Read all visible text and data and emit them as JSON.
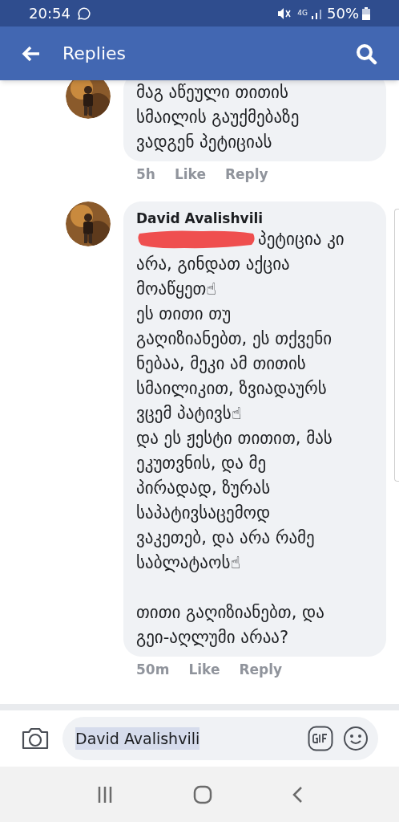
{
  "status_bar": {
    "time": "20:54",
    "battery": "50%",
    "network": "4G"
  },
  "header": {
    "title": "Replies"
  },
  "comments": [
    {
      "kind": "clipped",
      "paragraphs": [
        [
          "მაგ აწეული თითის",
          "სმაილის გაუქმებაზე",
          "ვადგენ პეტიციას"
        ]
      ],
      "time": "5h",
      "actions": [
        "Like",
        "Reply"
      ]
    },
    {
      "kind": "full",
      "author": "David Avalishvili",
      "redacted": true,
      "paragraphs": [
        [
          "პეტიცია კი",
          "არა, გინდათ აქცია",
          "მოაწყეთ☝",
          "ეს თითი თუ",
          "გაღიზიანებთ, ეს თქვენი",
          "ნებაა, მეკი ამ თითის",
          "სმაილიკით, ზვიადაურს",
          "ვცემ პატივს☝",
          "და ეს ჟესტი თითით, მას",
          "ეკუთვნის, და მე",
          "პირადად, ზურას",
          "საპატივსაცემოდ",
          "ვაკეთებ, და არა რამე",
          "საბლატაოს☝"
        ],
        [
          "თითი გაღიზიანებთ, და",
          "გეი-აღლუმი არაა?"
        ]
      ],
      "time": "50m",
      "actions": [
        "Like",
        "Reply"
      ]
    }
  ],
  "composer": {
    "value": "David Avalishvili",
    "selected": true
  }
}
